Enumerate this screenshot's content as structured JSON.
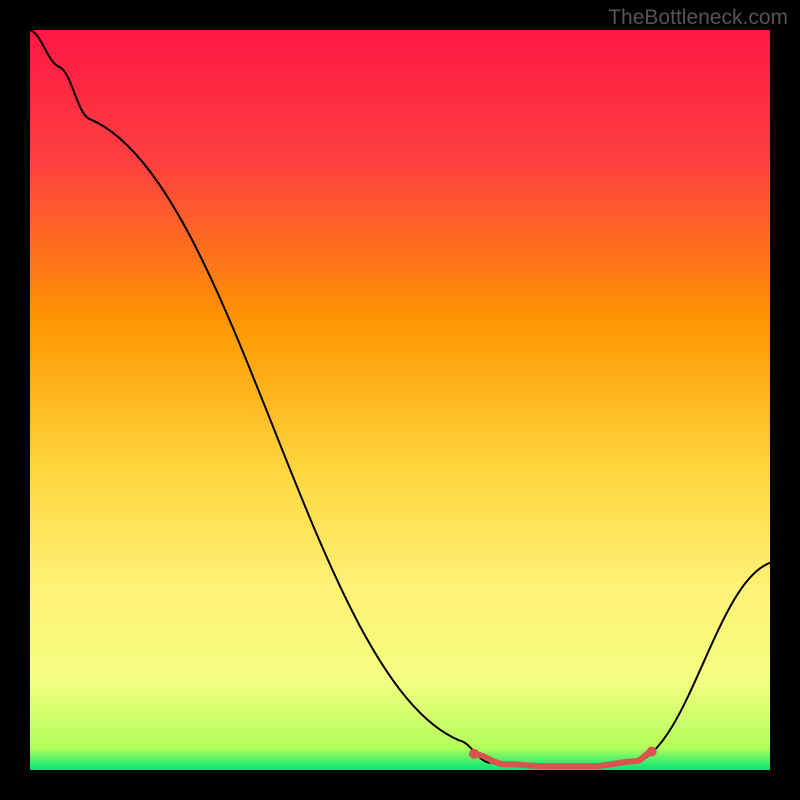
{
  "attribution": "TheBottleneck.com",
  "chart_data": {
    "type": "line",
    "title": "",
    "xlabel": "",
    "ylabel": "",
    "xlim": [
      0,
      100
    ],
    "ylim": [
      0,
      100
    ],
    "gradient_stops": [
      {
        "offset": 0,
        "color": "#ff1744"
      },
      {
        "offset": 18,
        "color": "#ff4040"
      },
      {
        "offset": 40,
        "color": "#ff9800"
      },
      {
        "offset": 60,
        "color": "#ffd740"
      },
      {
        "offset": 75,
        "color": "#fff176"
      },
      {
        "offset": 88,
        "color": "#f4ff81"
      },
      {
        "offset": 97,
        "color": "#b2ff59"
      },
      {
        "offset": 100,
        "color": "#00e676"
      }
    ],
    "series": [
      {
        "name": "bottleneck-curve",
        "color": "#000000",
        "width": 2,
        "points": [
          {
            "x": 0,
            "y": 100
          },
          {
            "x": 4,
            "y": 95
          },
          {
            "x": 8,
            "y": 88
          },
          {
            "x": 58,
            "y": 4
          },
          {
            "x": 62,
            "y": 1
          },
          {
            "x": 68,
            "y": 0.5
          },
          {
            "x": 78,
            "y": 0.5
          },
          {
            "x": 82,
            "y": 1
          },
          {
            "x": 100,
            "y": 28
          }
        ]
      },
      {
        "name": "bottom-highlight",
        "color": "#d9534f",
        "width": 6,
        "points": [
          {
            "x": 60,
            "y": 2.2
          },
          {
            "x": 64,
            "y": 0.8
          },
          {
            "x": 70,
            "y": 0.5
          },
          {
            "x": 76,
            "y": 0.5
          },
          {
            "x": 82,
            "y": 1.2
          },
          {
            "x": 84,
            "y": 2.5
          }
        ]
      }
    ]
  }
}
